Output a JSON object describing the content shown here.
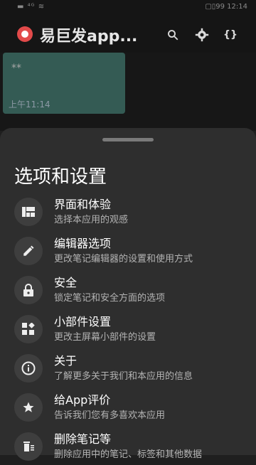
{
  "status": {
    "left": "▬ ⁴ᴳ ≋",
    "right": "▢▯99 12:14"
  },
  "app": {
    "title": "易巨发app...",
    "icons": [
      "logo-icon",
      "search-icon",
      "gear-icon",
      "braces-icon"
    ]
  },
  "note": {
    "text": "**",
    "time": "上午11:14",
    "color": "#467a70"
  },
  "sheet": {
    "title": "选项和设置",
    "items": [
      {
        "icon": "dashboard-icon",
        "title": "界面和体验",
        "subtitle": "选择本应用的观感"
      },
      {
        "icon": "pencil-icon",
        "title": "编辑器选项",
        "subtitle": "更改笔记编辑器的设置和使用方式"
      },
      {
        "icon": "lock-icon",
        "title": "安全",
        "subtitle": "锁定笔记和安全方面的选项"
      },
      {
        "icon": "widgets-icon",
        "title": "小部件设置",
        "subtitle": "更改主屏幕小部件的设置"
      },
      {
        "icon": "info-icon",
        "title": "关于",
        "subtitle": "了解更多关于我们和本应用的信息"
      },
      {
        "icon": "star-icon",
        "title": "给App评价",
        "subtitle": "告诉我们您有多喜欢本应用"
      },
      {
        "icon": "trash-icon",
        "title": "删除笔记等",
        "subtitle": "删除应用中的笔记、标签和其他数据"
      }
    ]
  }
}
